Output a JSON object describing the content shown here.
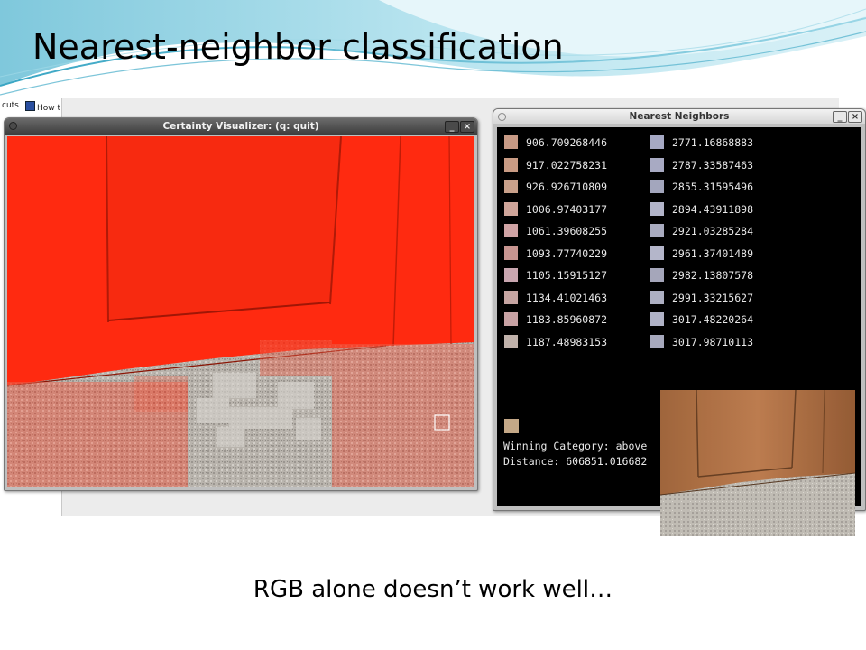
{
  "slide": {
    "title": "Nearest-neighbor classification",
    "caption": "RGB alone doesn’t work well…"
  },
  "desktop": {
    "tab_fragments": [
      "cuts",
      "How t"
    ]
  },
  "certainty_window": {
    "title": "Certainty Visualizer: (q: quit)",
    "minimize_label": "_",
    "close_label": "×"
  },
  "nn_window": {
    "title": "Nearest Neighbors",
    "minimize_label": "_",
    "close_label": "×",
    "left_column": [
      {
        "distance": "906.709268446",
        "swatch": "#c79a85"
      },
      {
        "distance": "917.022758231",
        "swatch": "#c99b84"
      },
      {
        "distance": "926.926710809",
        "swatch": "#c9a08a"
      },
      {
        "distance": "1006.97403177",
        "swatch": "#cfa59a"
      },
      {
        "distance": "1061.39608255",
        "swatch": "#d0a3a4"
      },
      {
        "distance": "1093.77740229",
        "swatch": "#c79490"
      },
      {
        "distance": "1105.15915127",
        "swatch": "#c9a6b0"
      },
      {
        "distance": "1134.41021463",
        "swatch": "#c5a4a1"
      },
      {
        "distance": "1183.85960872",
        "swatch": "#c7a1a3"
      },
      {
        "distance": "1187.48983153",
        "swatch": "#c0b1aa"
      }
    ],
    "right_column": [
      {
        "distance": "2771.16868883",
        "swatch": "#a6a9c4"
      },
      {
        "distance": "2787.33587463",
        "swatch": "#a8aac3"
      },
      {
        "distance": "2855.31595496",
        "swatch": "#a3a6bd"
      },
      {
        "distance": "2894.43911898",
        "swatch": "#b2b4c9"
      },
      {
        "distance": "2921.03285284",
        "swatch": "#a9abbf"
      },
      {
        "distance": "2961.37401489",
        "swatch": "#b4b6ca"
      },
      {
        "distance": "2982.13807578",
        "swatch": "#a5a6ba"
      },
      {
        "distance": "2991.33215627",
        "swatch": "#adafc2"
      },
      {
        "distance": "3017.48220264",
        "swatch": "#b0b2c6"
      },
      {
        "distance": "3017.98710113",
        "swatch": "#a7a9bd"
      }
    ],
    "winning_category": "Winning Category: above",
    "distance": "Distance: 606851.016682"
  },
  "colors": {
    "overlay_red": "#ff2a10",
    "carpet": "#b5b1ab",
    "wood": "#b06a3c"
  }
}
